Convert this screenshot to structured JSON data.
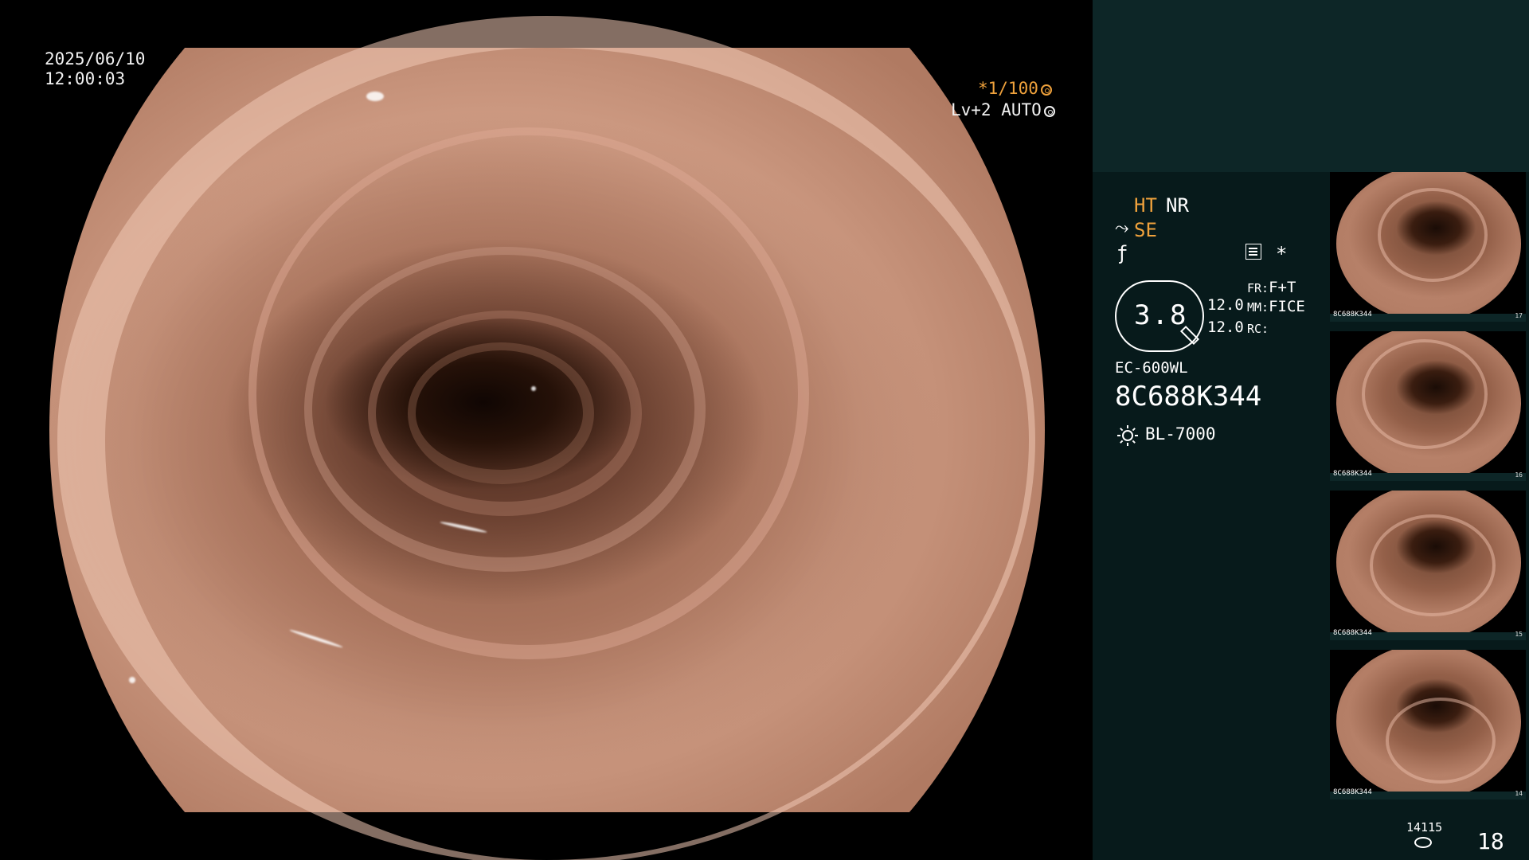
{
  "overlay": {
    "date": "2025/06/10",
    "time": "12:00:03",
    "shutter": "*1/100",
    "shutter_icon": "aperture-icon",
    "level": "Lv+2 AUTO",
    "level_icon": "iris-icon"
  },
  "panel": {
    "ht": "HT",
    "nr": "NR",
    "se_icon": "edge-enhance-icon",
    "se": "SE",
    "f_icon": "f-curve-icon",
    "doc_icon": "settings-sheet-icon",
    "asterisk": "*",
    "zoom": "3.8",
    "value_1": "12.0",
    "value_2": "12.0",
    "fr_label": "FR:",
    "fr_value": "F+T",
    "mm_label": "MM:",
    "mm_value": "FICE",
    "rc_label": "RC:",
    "scope_model": "EC-600WL",
    "scope_serial": "8C688K344",
    "light_icon": "light-source-icon",
    "light_source": "BL-7000"
  },
  "thumbnails": [
    {
      "serial": "8C688K344",
      "index": "17"
    },
    {
      "serial": "8C688K344",
      "index": "16"
    },
    {
      "serial": "8C688K344",
      "index": "15"
    },
    {
      "serial": "8C688K344",
      "index": "14"
    }
  ],
  "footer": {
    "counter": "14115",
    "disk_icon": "storage-disk-icon",
    "page": "18"
  },
  "colors": {
    "accent_orange": "#f0a23c",
    "panel_bg": "#071a1b",
    "panel_top_bg": "#0d2627"
  }
}
